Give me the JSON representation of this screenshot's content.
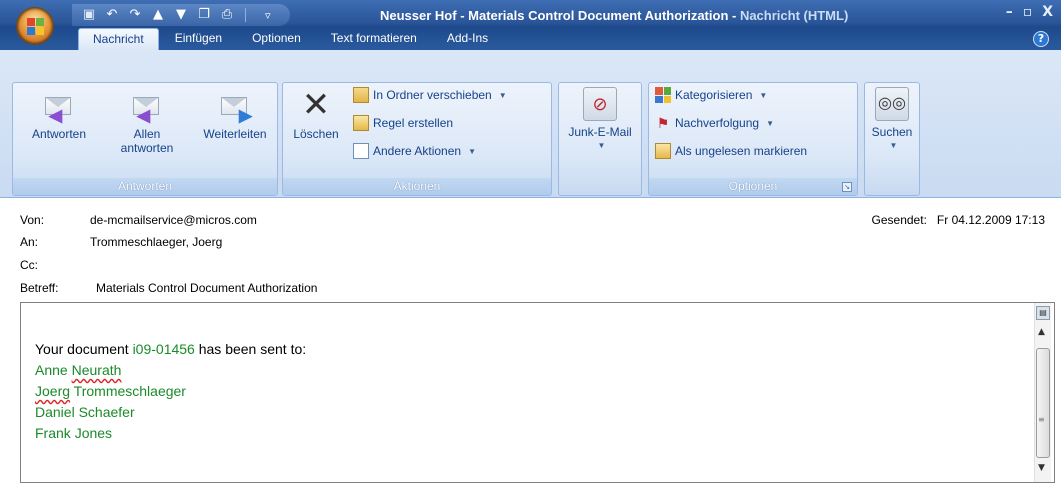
{
  "window": {
    "title_main": "Neusser Hof - Materials Control Document Authorization - ",
    "title_accent": "Nachricht (HTML)",
    "minimize_label": "–",
    "restore_label": "▫",
    "close_label": "X"
  },
  "qat": {
    "more_label": "▿"
  },
  "tabs": [
    {
      "label": "Nachricht"
    },
    {
      "label": "Einfügen"
    },
    {
      "label": "Optionen"
    },
    {
      "label": "Text formatieren"
    },
    {
      "label": "Add-Ins"
    }
  ],
  "help_label": "?",
  "ribbon": {
    "groups": {
      "antworten": {
        "label": "Antworten",
        "reply": "Antworten",
        "reply_all_1": "Allen",
        "reply_all_2": "antworten",
        "forward": "Weiterleiten"
      },
      "aktionen": {
        "label": "Aktionen",
        "delete": "Löschen",
        "move": "In Ordner verschieben",
        "rule": "Regel erstellen",
        "other": "Andere Aktionen"
      },
      "junk": {
        "label": "Junk-E-Mail"
      },
      "optionen": {
        "label": "Optionen",
        "categorize": "Kategorisieren",
        "followup": "Nachverfolgung",
        "mark_unread": "Als ungelesen markieren"
      },
      "suchen": {
        "label": "Suchen"
      }
    }
  },
  "header": {
    "from_label": "Von:",
    "from_value": "de-mcmailservice@micros.com",
    "to_label": "An:",
    "to_value": "Trommeschlaeger, Joerg",
    "cc_label": "Cc:",
    "cc_value": "",
    "subject_label": "Betreff:",
    "subject_value": "Materials Control Document Authorization",
    "sent_label": "Gesendet:",
    "sent_value": "Fr 04.12.2009 17:13"
  },
  "body": {
    "line1_pre": "Your document ",
    "doc_id": "i09-01456",
    "line1_post": " has been sent to:",
    "recipients": [
      {
        "first": "Anne",
        "last": "Neurath"
      },
      {
        "first": "Joerg",
        "last": "Trommeschlaeger"
      },
      {
        "first": "Daniel",
        "last": "Schaefer"
      },
      {
        "first": "Frank",
        "last": "Jones"
      }
    ]
  },
  "colors": {
    "title_bar": "#2a5598",
    "ribbon_bg": "#dbe7f6",
    "recipient_text": "#1a8a2a"
  }
}
